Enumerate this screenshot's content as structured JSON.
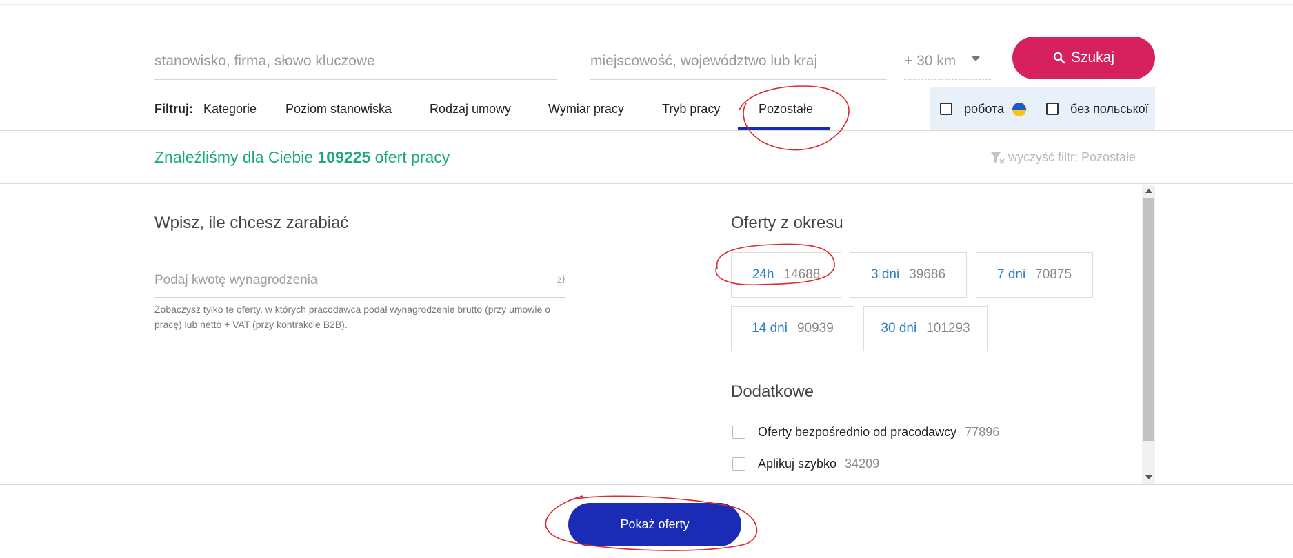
{
  "search": {
    "keyword_placeholder": "stanowisko, firma, słowo kluczowe",
    "location_placeholder": "miejscowość, województwo lub kraj",
    "distance": "+ 30 km",
    "search_label": "Szukaj"
  },
  "filters": {
    "label": "Filtruj:",
    "tabs": [
      {
        "label": "Kategorie"
      },
      {
        "label": "Poziom stanowiska"
      },
      {
        "label": "Rodzaj umowy"
      },
      {
        "label": "Wymiar pracy"
      },
      {
        "label": "Tryb pracy"
      },
      {
        "label": "Pozostałe",
        "active": true
      }
    ],
    "ukraine_options": [
      {
        "label": "робота"
      },
      {
        "label": "без польської"
      }
    ]
  },
  "results": {
    "prefix": "Znaleźliśmy dla Ciebie",
    "count": "109225",
    "suffix": "ofert pracy",
    "clear_filter": "wyczyść filtr: Pozostałe"
  },
  "salary": {
    "heading": "Wpisz, ile chcesz zarabiać",
    "placeholder": "Podaj kwotę wynagrodzenia",
    "currency": "zł",
    "note": "Zobaczysz tylko te oferty, w których pracodawca podał wynagrodzenie brutto (przy umowie o pracę) lub netto + VAT (przy kontrakcie B2B)."
  },
  "period": {
    "heading": "Oferty z okresu",
    "options": [
      {
        "label": "24h",
        "count": "14688"
      },
      {
        "label": "3 dni",
        "count": "39686"
      },
      {
        "label": "7 dni",
        "count": "70875"
      },
      {
        "label": "14 dni",
        "count": "90939"
      },
      {
        "label": "30 dni",
        "count": "101293"
      }
    ]
  },
  "extra": {
    "heading": "Dodatkowe",
    "options": [
      {
        "label": "Oferty bezpośrednio od pracodawcy",
        "count": "77896"
      },
      {
        "label": "Aplikuj szybko",
        "count": "34209"
      }
    ]
  },
  "footer": {
    "show_offers": "Pokaż oferty"
  },
  "colors": {
    "brand_pink": "#d6215e",
    "brand_blue": "#1a2bb5",
    "success_green": "#1aaa7a",
    "link_blue": "#2b7bc4",
    "annotation_red": "#e0262e"
  }
}
